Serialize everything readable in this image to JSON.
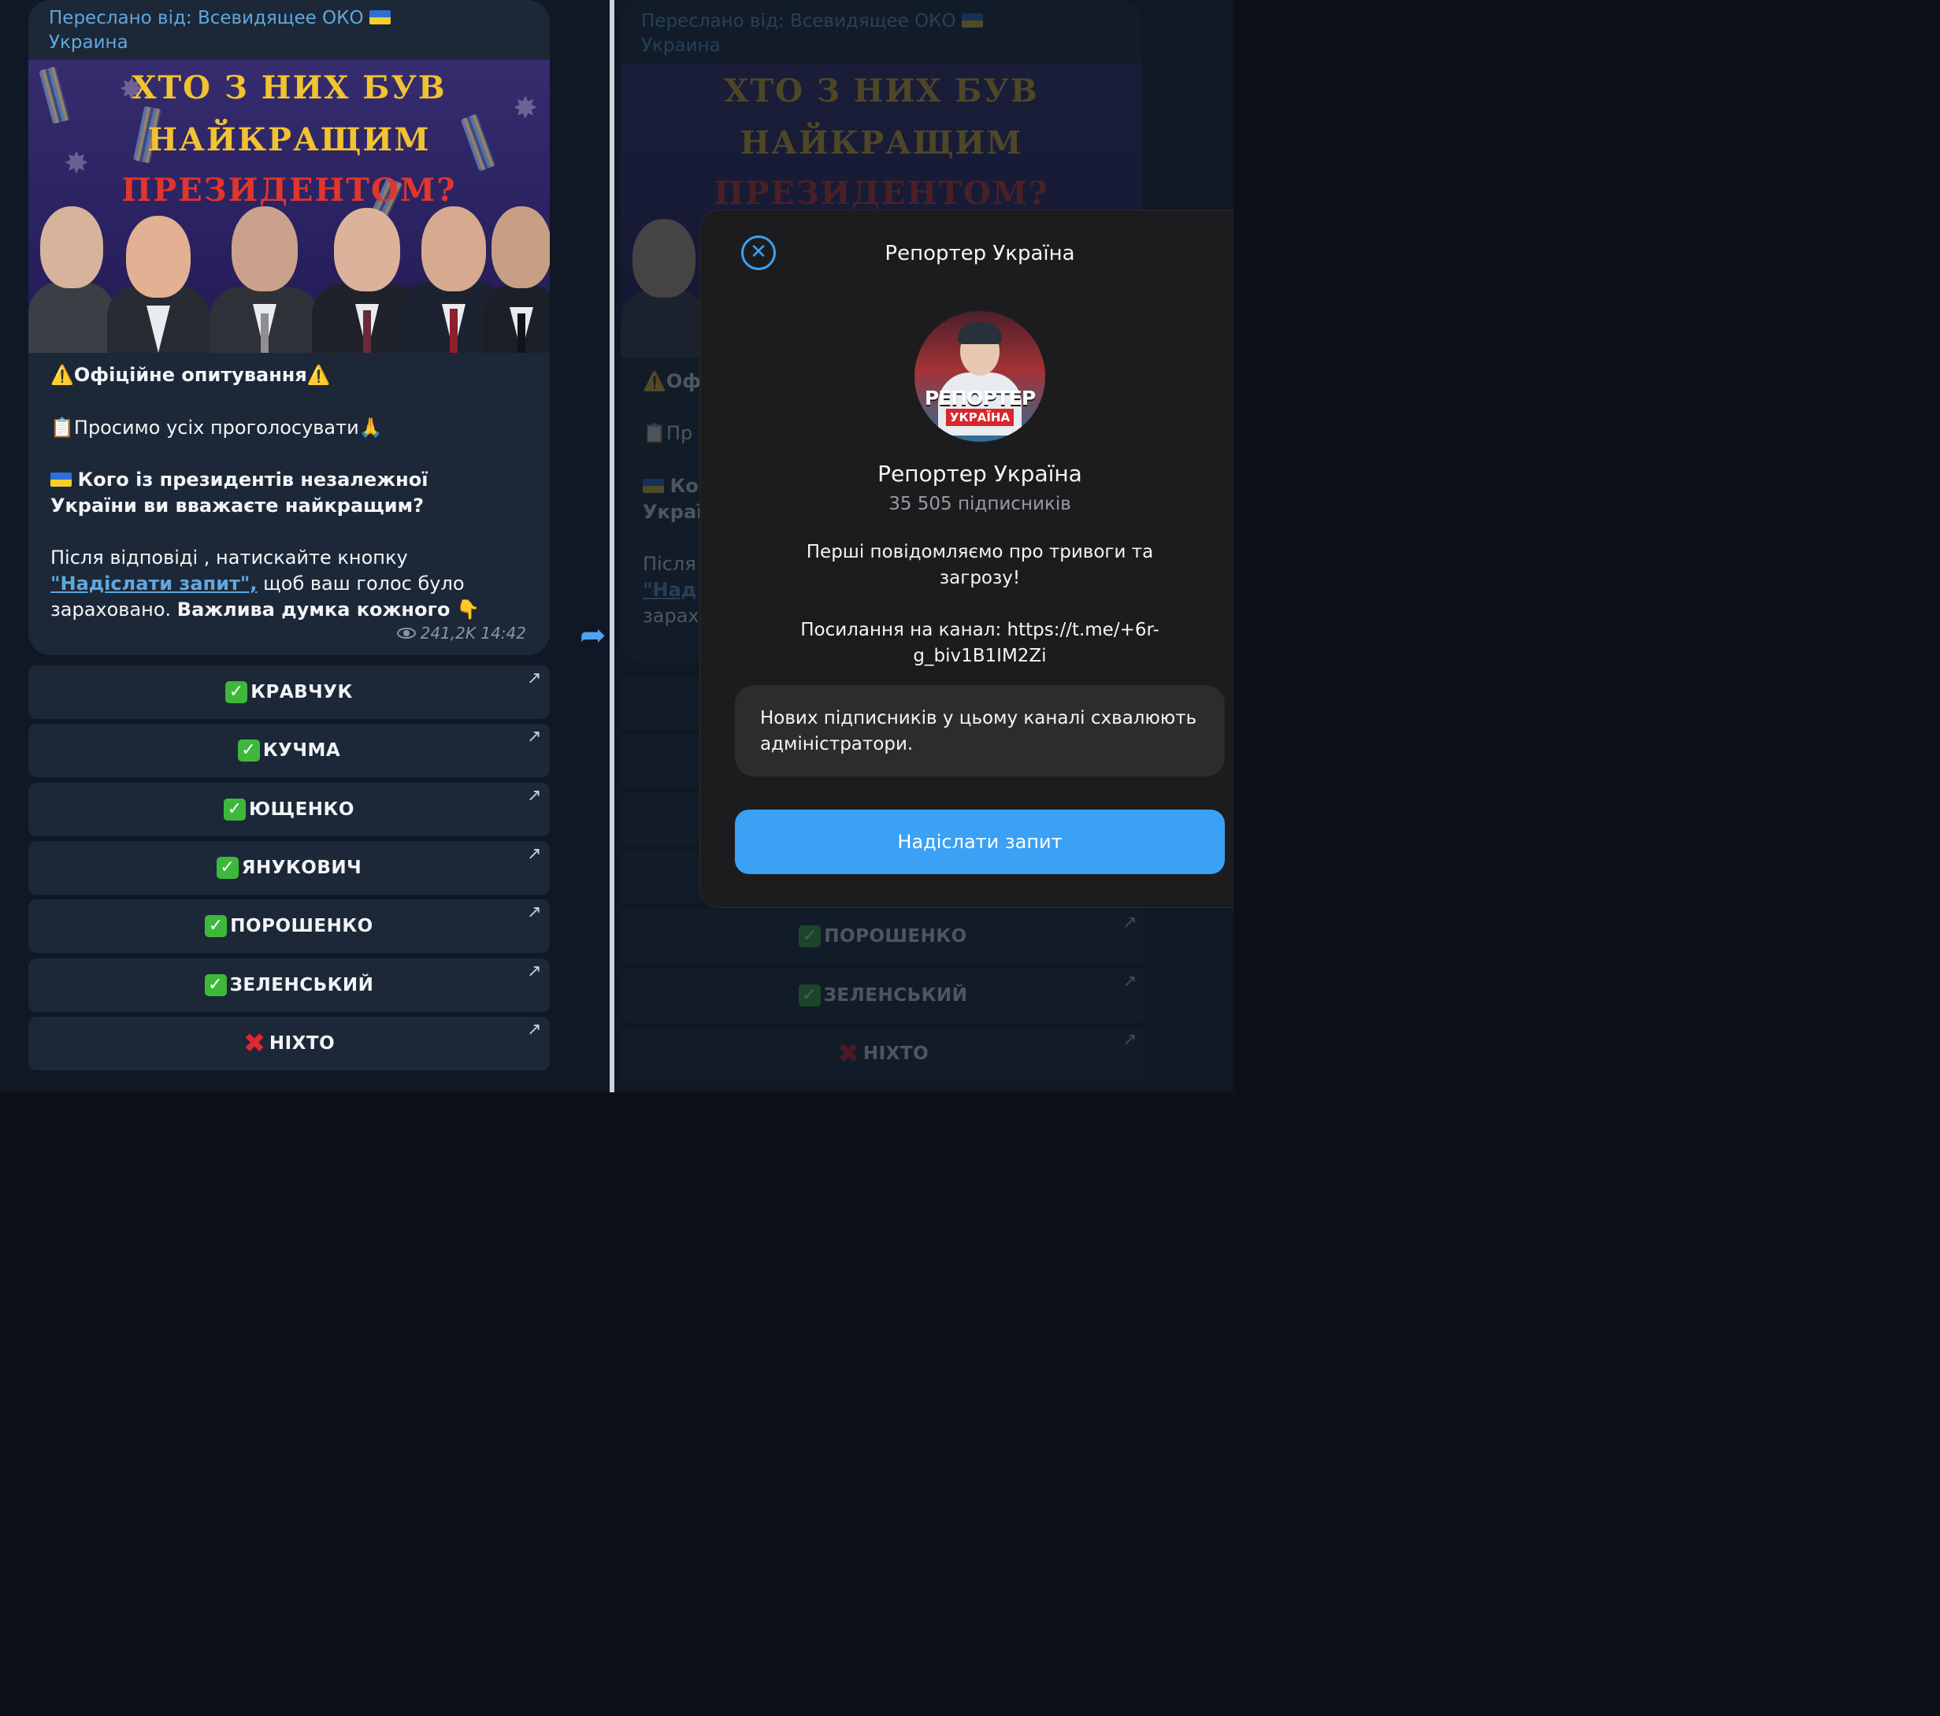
{
  "message": {
    "forwarded_prefix": "Переслано від:",
    "forwarded_source": "Всевидящее ОКО",
    "forwarded_source_line2": "Украина",
    "poster": {
      "line1": "ХТО З НИХ БУВ",
      "line2": "НАЙКРАЩИМ",
      "line3": "ПРЕЗИДЕНТОМ?"
    },
    "official": "Офіційне опитування",
    "ask": "Просимо усіх проголосувати",
    "question_line1": "Кого із президентів незалежної",
    "question_line2": "України ви вважаєте найкращим?",
    "after_line1": "Після відповіді , натискайте кнопку",
    "link_text": "\"Надіслати запит\",",
    "after_line2_tail": " щоб ваш голос було",
    "after_line3_plain": "зараховано. ",
    "after_line3_bold": "Важлива думка кожного",
    "views": "241,2K",
    "time": "14:42"
  },
  "buttons": [
    {
      "label": "КРАВЧУК",
      "mark": "check"
    },
    {
      "label": "КУЧМА",
      "mark": "check"
    },
    {
      "label": "ЮЩЕНКО",
      "mark": "check"
    },
    {
      "label": "ЯНУКОВИЧ",
      "mark": "check"
    },
    {
      "label": "ПОРОШЕНКО",
      "mark": "check"
    },
    {
      "label": "ЗЕЛЕНСЬКИЙ",
      "mark": "check"
    },
    {
      "label": "НІХТО",
      "mark": "cross"
    }
  ],
  "right": {
    "dim": {
      "visible_buttons": [
        "ПОРОШЕНКО",
        "ЗЕЛЕНСЬКИЙ",
        "НІХТО"
      ],
      "peek_official": "Оф",
      "peek_ask": "Пр",
      "peek_q1": "Ко",
      "peek_q2": "Украї",
      "peek_after": "Після",
      "peek_link": "\"Над",
      "peek_zarah": "зарах"
    },
    "sheet": {
      "title": "Репортер Україна",
      "avatar_logo_line1": "РЕПОРТЕР",
      "avatar_logo_line2": "УКРАЇНА",
      "channel_name": "Репортер Україна",
      "subscribers": "35 505 підписників",
      "desc_line1": "Перші повідомляємо про тривоги та",
      "desc_line2": "загрозу!",
      "link_line1": "Посилання на канал: https://t.me/+6r-",
      "link_line2": "g_biv1B1IM2Zi",
      "note": "Нових підписників у цьому каналі схвалюють адміністратори.",
      "send_button": "Надіслати запит"
    }
  },
  "colors": {
    "accent_link": "#5fa8de",
    "send_button": "#3aa1f5",
    "check_green": "#3eb83b",
    "cross_red": "#e2262d"
  }
}
